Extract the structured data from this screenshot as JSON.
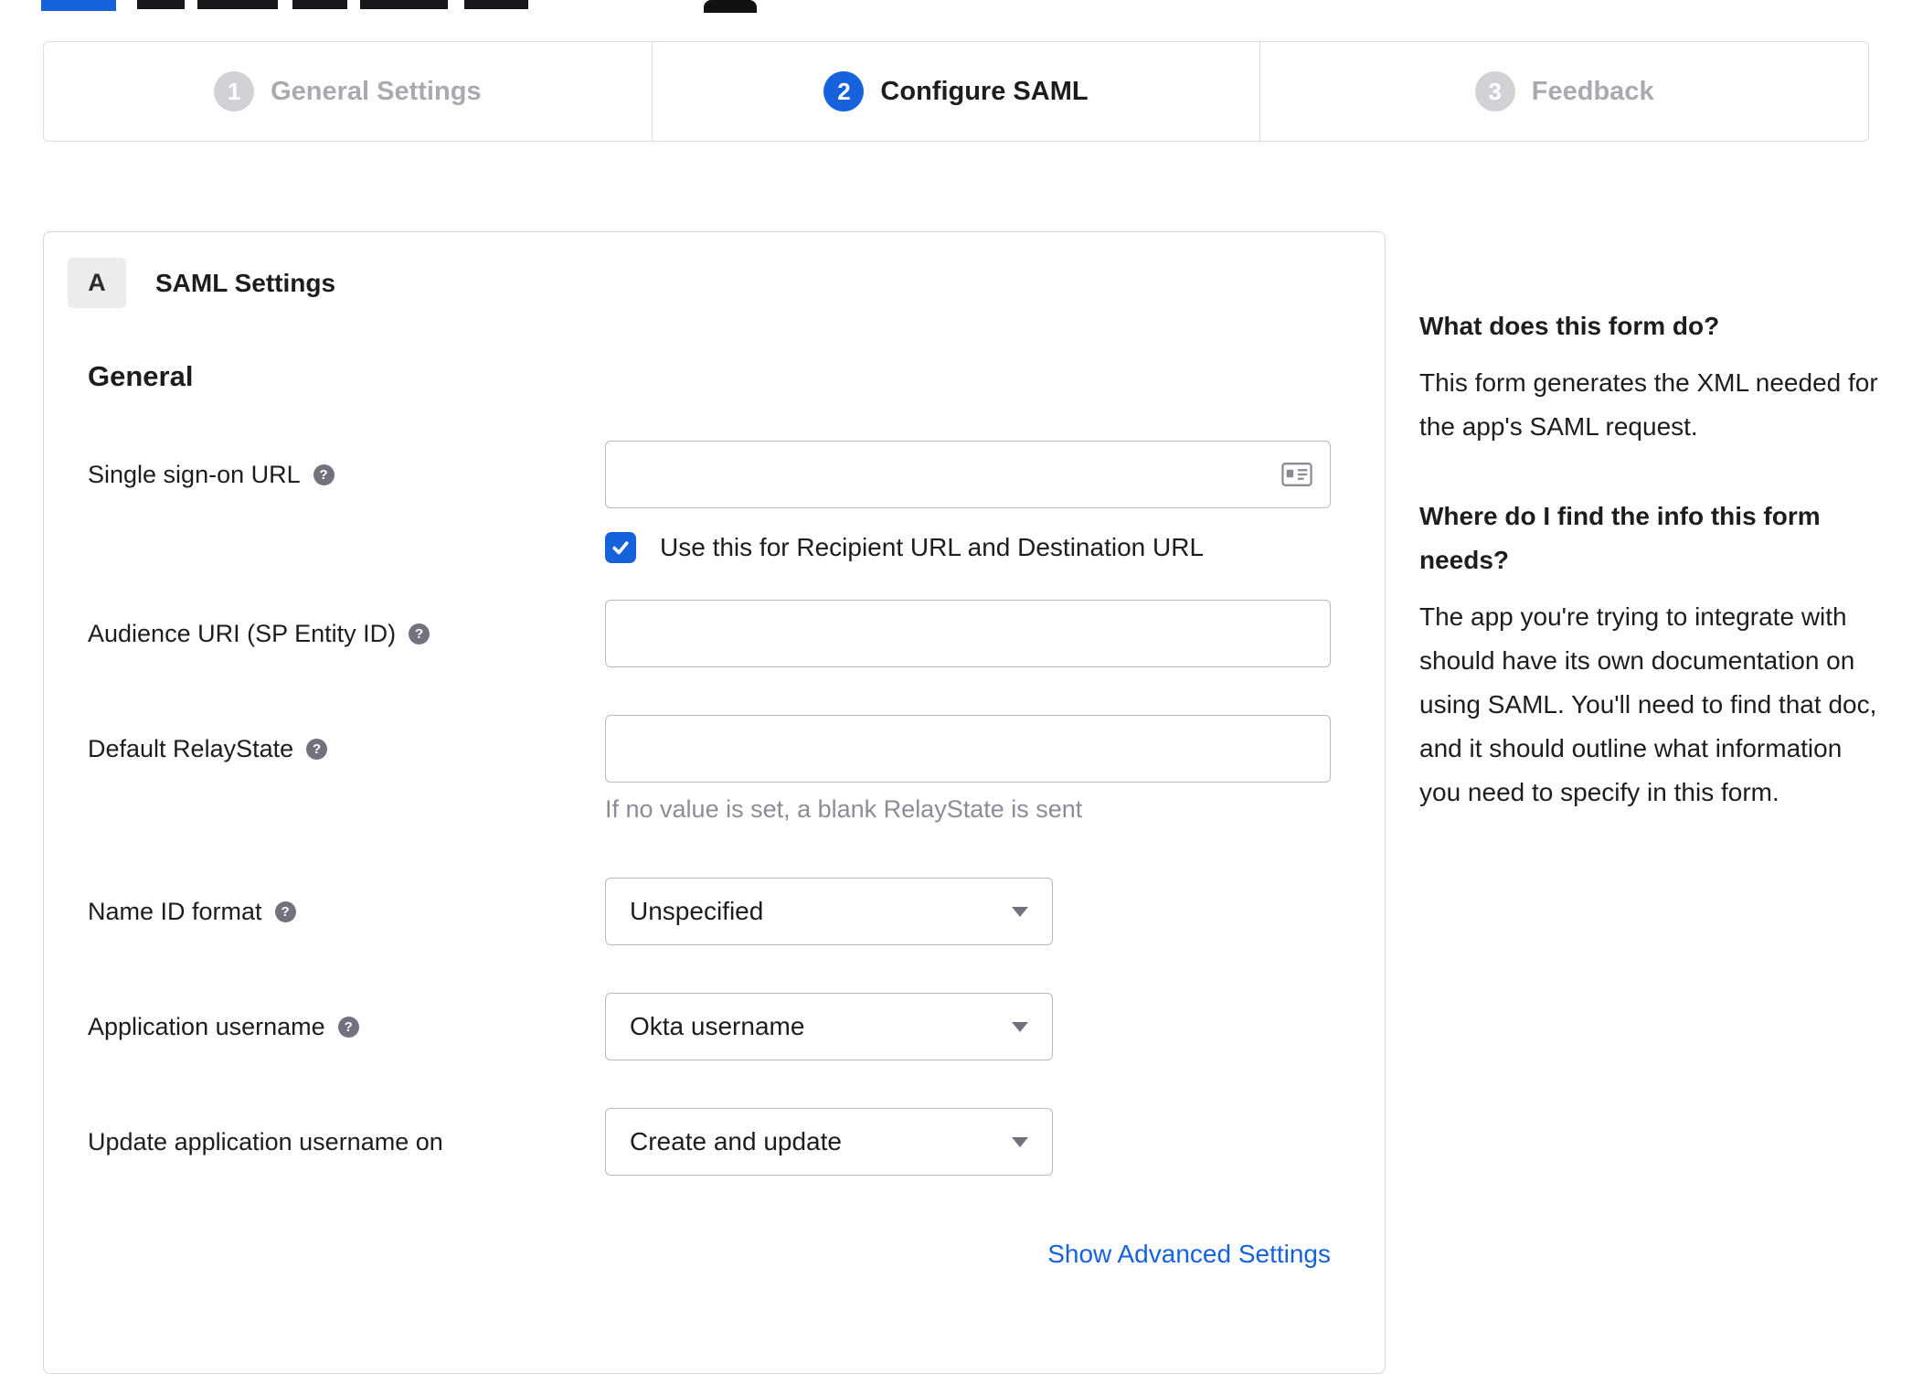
{
  "stepper": {
    "steps": [
      {
        "number": "1",
        "label": "General Settings",
        "state": "inactive"
      },
      {
        "number": "2",
        "label": "Configure SAML",
        "state": "active"
      },
      {
        "number": "3",
        "label": "Feedback",
        "state": "inactive"
      }
    ]
  },
  "panel": {
    "section_badge": "A",
    "section_title": "SAML Settings",
    "group_title": "General",
    "fields": {
      "sso_url": {
        "label": "Single sign-on URL",
        "value": "",
        "checkbox_label": "Use this for Recipient URL and Destination URL",
        "checkbox_checked": true
      },
      "audience_uri": {
        "label": "Audience URI (SP Entity ID)",
        "value": ""
      },
      "relay_state": {
        "label": "Default RelayState",
        "value": "",
        "hint": "If no value is set, a blank RelayState is sent"
      },
      "name_id_format": {
        "label": "Name ID format",
        "value": "Unspecified"
      },
      "app_username": {
        "label": "Application username",
        "value": "Okta username"
      },
      "update_username": {
        "label": "Update application username on",
        "value": "Create and update"
      }
    },
    "advanced_link": "Show Advanced Settings"
  },
  "sidebar": {
    "sections": [
      {
        "heading": "What does this form do?",
        "body": "This form generates the XML needed for the app's SAML request."
      },
      {
        "heading": "Where do I find the info this form needs?",
        "body": "The app you're trying to integrate with should have its own documentation on using SAML. You'll need to find that doc, and it should outline what information you need to specify in this form."
      }
    ]
  },
  "icons": {
    "help_glyph": "?",
    "checkbox_icon": "checkmark",
    "card_icon": "address-card",
    "caret_icon": "chevron-down"
  },
  "colors": {
    "accent_blue": "#1662dd",
    "inactive_gray": "#d2d2d6",
    "text": "#1d1d21",
    "border": "#dcdce0",
    "hint_gray": "#8c8c96"
  }
}
